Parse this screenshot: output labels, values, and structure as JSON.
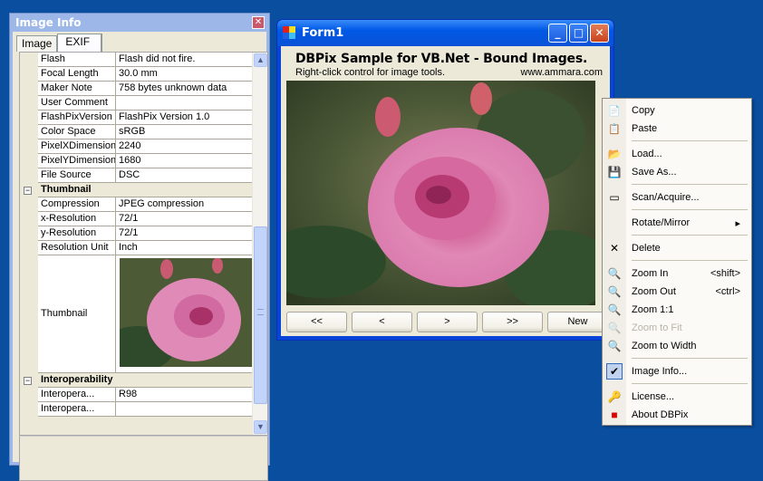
{
  "image_info": {
    "title": "Image Info",
    "close_icon": "close-icon",
    "tabs": [
      {
        "label": "Image",
        "active": false
      },
      {
        "label": "EXIF",
        "active": true
      }
    ],
    "rows": [
      {
        "type": "prop",
        "key": "Flash",
        "value": "Flash did not fire."
      },
      {
        "type": "prop",
        "key": "Focal Length",
        "value": "30.0 mm"
      },
      {
        "type": "prop",
        "key": "Maker Note",
        "value": "758 bytes unknown data"
      },
      {
        "type": "prop",
        "key": "User Comment",
        "value": ""
      },
      {
        "type": "prop",
        "key": "FlashPixVersion",
        "value": "FlashPix Version 1.0"
      },
      {
        "type": "prop",
        "key": "Color Space",
        "value": "sRGB"
      },
      {
        "type": "prop",
        "key": "PixelXDimension",
        "value": "2240"
      },
      {
        "type": "prop",
        "key": "PixelYDimension",
        "value": "1680"
      },
      {
        "type": "prop",
        "key": "File Source",
        "value": "DSC"
      },
      {
        "type": "category",
        "key": "Thumbnail",
        "expander": "−"
      },
      {
        "type": "prop",
        "key": "Compression",
        "value": "JPEG compression"
      },
      {
        "type": "prop",
        "key": "x-Resolution",
        "value": "72/1"
      },
      {
        "type": "prop",
        "key": "y-Resolution",
        "value": "72/1"
      },
      {
        "type": "prop",
        "key": "Resolution Unit",
        "value": "Inch"
      },
      {
        "type": "thumb",
        "key": "Thumbnail",
        "value": "rose-thumbnail-image"
      },
      {
        "type": "category",
        "key": "Interoperability",
        "expander": "−"
      },
      {
        "type": "prop",
        "key": "Interopera...",
        "value": "R98"
      },
      {
        "type": "prop",
        "key": "Interopera...",
        "value": ""
      }
    ],
    "scroll_up": "▲",
    "scroll_down": "▼"
  },
  "form1": {
    "title": "Form1",
    "heading": "DBPix Sample for VB.Net - Bound Images.",
    "subtitle": "Right-click control for image tools.",
    "url": "www.ammara.com",
    "window_buttons": {
      "minimize": "_",
      "maximize": "□",
      "close": "✕"
    },
    "nav_buttons": [
      {
        "label": "<<",
        "name": "first-record-button"
      },
      {
        "label": "<",
        "name": "previous-record-button"
      },
      {
        "label": ">",
        "name": "next-record-button"
      },
      {
        "label": ">>",
        "name": "last-record-button"
      },
      {
        "label": "New",
        "name": "new-record-button"
      }
    ]
  },
  "context_menu": {
    "items": [
      {
        "label": "Copy",
        "icon": "📄",
        "icon_name": "copy-icon"
      },
      {
        "label": "Paste",
        "icon": "📋",
        "icon_name": "paste-icon"
      },
      {
        "sep": true
      },
      {
        "label": "Load...",
        "icon": "📂",
        "icon_name": "folder-open-icon"
      },
      {
        "label": "Save As...",
        "icon": "💾",
        "icon_name": "floppy-disk-icon"
      },
      {
        "sep": true
      },
      {
        "label": "Scan/Acquire...",
        "icon": "▭",
        "icon_name": "scanner-icon"
      },
      {
        "sep": true
      },
      {
        "label": "Rotate/Mirror",
        "icon": "",
        "icon_name": "",
        "submenu": "▸"
      },
      {
        "sep": true
      },
      {
        "label": "Delete",
        "icon": "✕",
        "icon_name": "delete-x-icon"
      },
      {
        "sep": true
      },
      {
        "label": "Zoom In",
        "icon": "🔍",
        "icon_name": "zoom-in-icon",
        "shortcut": "<shift>"
      },
      {
        "label": "Zoom Out",
        "icon": "🔍",
        "icon_name": "zoom-out-icon",
        "shortcut": "<ctrl>"
      },
      {
        "label": "Zoom 1:1",
        "icon": "🔍",
        "icon_name": "zoom-actual-icon"
      },
      {
        "label": "Zoom to Fit",
        "icon": "🔍",
        "icon_name": "zoom-fit-icon",
        "disabled": true
      },
      {
        "label": "Zoom to Width",
        "icon": "🔍",
        "icon_name": "zoom-width-icon"
      },
      {
        "sep": true
      },
      {
        "label": "Image Info...",
        "icon": "✔",
        "icon_name": "checkmark-icon",
        "checked": true
      },
      {
        "sep": true
      },
      {
        "label": "License...",
        "icon": "🔑",
        "icon_name": "license-key-icon"
      },
      {
        "label": "About DBPix",
        "icon": "■",
        "icon_name": "about-red-icon"
      }
    ]
  },
  "colors": {
    "desktop": "#0a4ea0",
    "xp_blue_titlebar": "#0058e6",
    "tool_window_title": "#9db7e8",
    "face": "#ece9d8",
    "menu_bg": "#fbfaf6"
  }
}
